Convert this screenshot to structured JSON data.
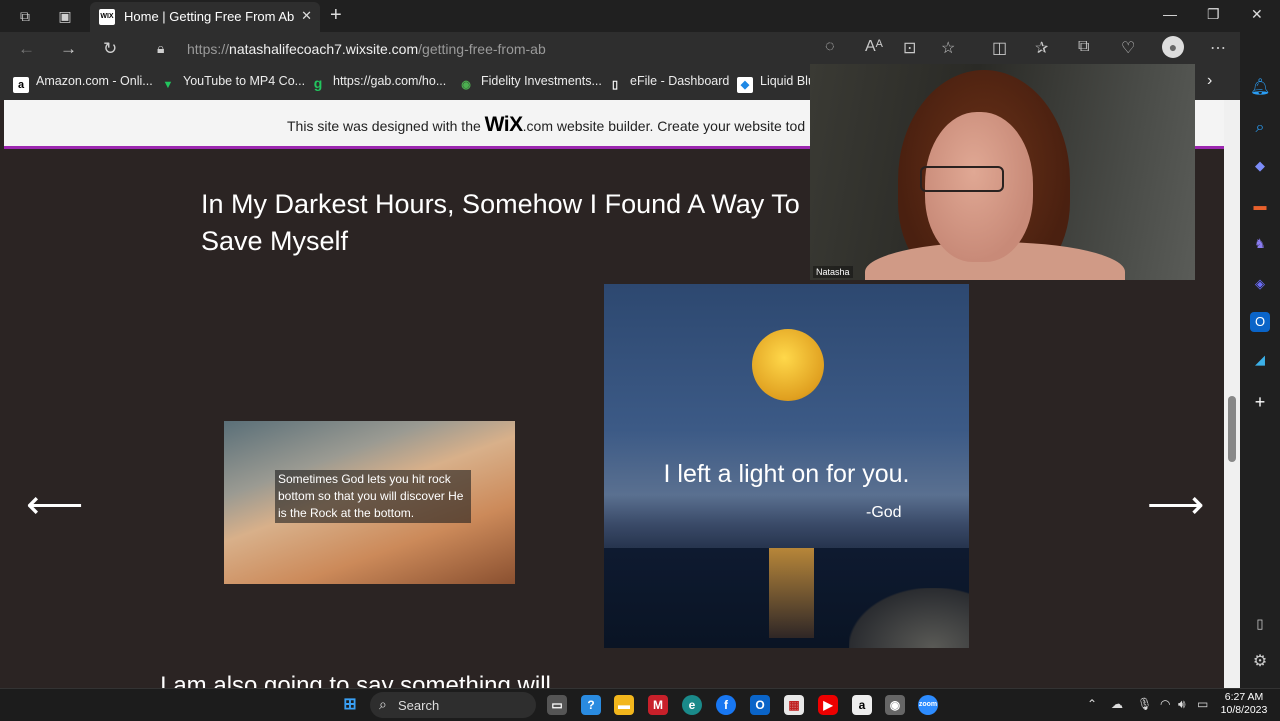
{
  "browser": {
    "tab_title": "Home | Getting Free From Ab",
    "tab_favicon_text": "WIX",
    "new_tab": "+",
    "url_prefix": "https://",
    "url_domain": "natashalifecoach7.wixsite.com",
    "url_path": "/getting-free-from-ab"
  },
  "bookmarks": [
    {
      "icon": "a",
      "label": "Amazon.com - Onli...",
      "icon_color": "#ffffff"
    },
    {
      "icon": "▼",
      "label": "YouTube to MP4 Co...",
      "icon_color": "#22c55e"
    },
    {
      "icon": "g",
      "label": "https://gab.com/ho...",
      "icon_color": "#22c55e"
    },
    {
      "icon": "◉",
      "label": "Fidelity Investments...",
      "icon_color": "#4caf50"
    },
    {
      "icon": "▯",
      "label": "eFile - Dashboard",
      "icon_color": "#ffffff"
    },
    {
      "icon": "◆",
      "label": "Liquid Blu",
      "icon_color": "#1e88e5"
    }
  ],
  "wix_banner": {
    "before": "This site was designed with the ",
    "brand": "WiX",
    "after": ".com website builder. Create your website tod"
  },
  "page": {
    "heading": "In My Darkest Hours, Somehow I Found A Way To Save Myself",
    "prev_arrow": "⟵",
    "next_arrow": "⟶",
    "image1_quote": "Sometimes God lets you hit rock bottom so that you will discover He is the Rock at the bottom.",
    "image2_main": "I left a light on for you.",
    "image2_sig": "-God",
    "next_section_text": "I am also going to say something will..."
  },
  "video": {
    "participant_name": "Natasha"
  },
  "taskbar": {
    "search_label": "Search",
    "time": "6:27 AM",
    "date": "10/8/2023"
  },
  "colors": {
    "page_bg": "#2b2423",
    "banner_accent": "#9c27b0"
  }
}
